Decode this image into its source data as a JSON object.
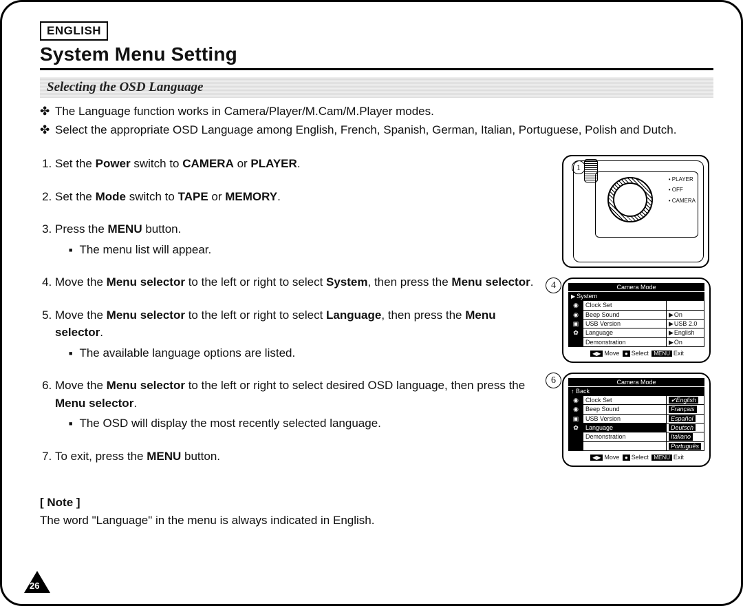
{
  "header": {
    "lang_tag": "ENGLISH",
    "title": "System Menu Setting",
    "subtitle": "Selecting the OSD Language"
  },
  "intro": {
    "b1": "The Language function works in Camera/Player/M.Cam/M.Player modes.",
    "b2": "Select the appropriate OSD Language among English, French, Spanish, German, Italian, Portuguese, Polish and Dutch."
  },
  "steps": {
    "s1a": "Set the ",
    "s1b": "Power",
    "s1c": " switch to ",
    "s1d": "CAMERA",
    "s1e": " or ",
    "s1f": "PLAYER",
    "s1g": ".",
    "s2a": "Set the ",
    "s2b": "Mode",
    "s2c": " switch to ",
    "s2d": "TAPE",
    "s2e": " or ",
    "s2f": "MEMORY",
    "s2g": ".",
    "s3a": "Press the ",
    "s3b": "MENU",
    "s3c": " button.",
    "s3sub": "The menu list will appear.",
    "s4a": "Move the ",
    "s4b": "Menu selector",
    "s4c": " to the left or right to select ",
    "s4d": "System",
    "s4e": ", then press the ",
    "s4f": "Menu selector",
    "s4g": ".",
    "s5a": "Move the ",
    "s5b": "Menu selector",
    "s5c": " to the left or right to select ",
    "s5d": "Language",
    "s5e": ", then press the ",
    "s5f": "Menu selector",
    "s5g": ".",
    "s5sub": "The available language options are listed.",
    "s6a": "Move the ",
    "s6b": "Menu selector",
    "s6c": " to the left or right to select desired OSD language, then press the ",
    "s6d": "Menu selector",
    "s6e": ".",
    "s6sub": "The OSD will display the most recently selected language.",
    "s7a": "To exit, press the ",
    "s7b": "MENU",
    "s7c": " button."
  },
  "note": {
    "label": "[ Note ]",
    "text": "The word \"Language\" in the menu is always indicated in English."
  },
  "cam": {
    "num": "1",
    "l1": "PLAYER",
    "l2": "OFF",
    "l3": "CAMERA"
  },
  "osd4": {
    "num": "4",
    "title": "Camera Mode",
    "sel": "System",
    "r1": "Clock Set",
    "r2": "Beep Sound",
    "v2": "On",
    "r3": "USB Version",
    "v3": "USB 2.0",
    "r4": "Language",
    "v4": "English",
    "r5": "Demonstration",
    "v5": "On",
    "foot_move": "Move",
    "foot_select": "Select",
    "foot_exit": "Exit"
  },
  "osd6": {
    "num": "6",
    "title": "Camera Mode",
    "back": "Back",
    "r1": "Clock Set",
    "v1": "English",
    "r2": "Beep Sound",
    "v2": "Français",
    "r3": "USB Version",
    "v3": "Español",
    "r4": "Language",
    "v4": "Deutsch",
    "r5": "Demonstration",
    "v5": "Italiano",
    "v6": "Português",
    "foot_move": "Move",
    "foot_select": "Select",
    "foot_exit": "Exit"
  },
  "page_number": "26"
}
